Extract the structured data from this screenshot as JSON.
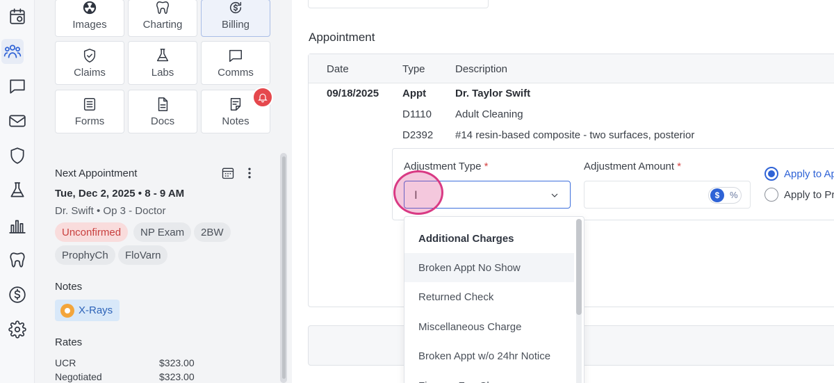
{
  "left_panel": {
    "tiles": [
      {
        "label": "Images",
        "icon": "radiation-icon"
      },
      {
        "label": "Charting",
        "icon": "tooth-icon"
      },
      {
        "label": "Billing",
        "icon": "dollar-refresh-icon"
      },
      {
        "label": "Claims",
        "icon": "shield-check-icon"
      },
      {
        "label": "Labs",
        "icon": "flask-icon"
      },
      {
        "label": "Comms",
        "icon": "chat-icon"
      },
      {
        "label": "Forms",
        "icon": "form-icon"
      },
      {
        "label": "Docs",
        "icon": "document-icon"
      },
      {
        "label": "Notes",
        "icon": "note-icon"
      }
    ],
    "next_appointment": {
      "title": "Next Appointment",
      "date": "Tue, Dec 2, 2025 • 8 - 9 AM",
      "provider": "Dr. Swift • Op 3 - Doctor",
      "chips": [
        "Unconfirmed",
        "NP Exam",
        "2BW",
        "ProphyCh",
        "FloVarn"
      ]
    },
    "notes": {
      "title": "Notes",
      "badge": "X-Rays"
    },
    "rates": {
      "title": "Rates",
      "rows": [
        {
          "label": "UCR",
          "value": "$323.00"
        },
        {
          "label": "Negotiated",
          "value": "$323.00"
        }
      ]
    }
  },
  "main": {
    "section_title": "Appointment",
    "table": {
      "headers": [
        "Date",
        "Type",
        "Description"
      ],
      "rows": [
        {
          "date": "09/18/2025",
          "type": "Appt",
          "description": "Dr. Taylor Swift"
        },
        {
          "date": "",
          "type": "D1110",
          "description": "Adult Cleaning"
        },
        {
          "date": "",
          "type": "D2392",
          "description": "#14 resin-based composite - two surfaces, posterior"
        }
      ]
    },
    "adjustment": {
      "type_label": "Adjustment Type",
      "amount_label": "Adjustment Amount",
      "required_mark": "*",
      "select_value": "",
      "toggle_dollar": "$",
      "toggle_percent": "%",
      "apply_options": [
        "Apply to Ap",
        "Apply to Pr"
      ]
    },
    "dropdown": {
      "header": "Additional Charges",
      "items": [
        "Broken Appt No Show",
        "Returned Check",
        "Miscellaneous Charge",
        "Broken Appt w/o 24hr Notice",
        "Finance Fee Charge"
      ]
    }
  },
  "colors": {
    "accent": "#2f63d6",
    "alert": "#e5484d",
    "click_highlight": "#d93a84"
  }
}
